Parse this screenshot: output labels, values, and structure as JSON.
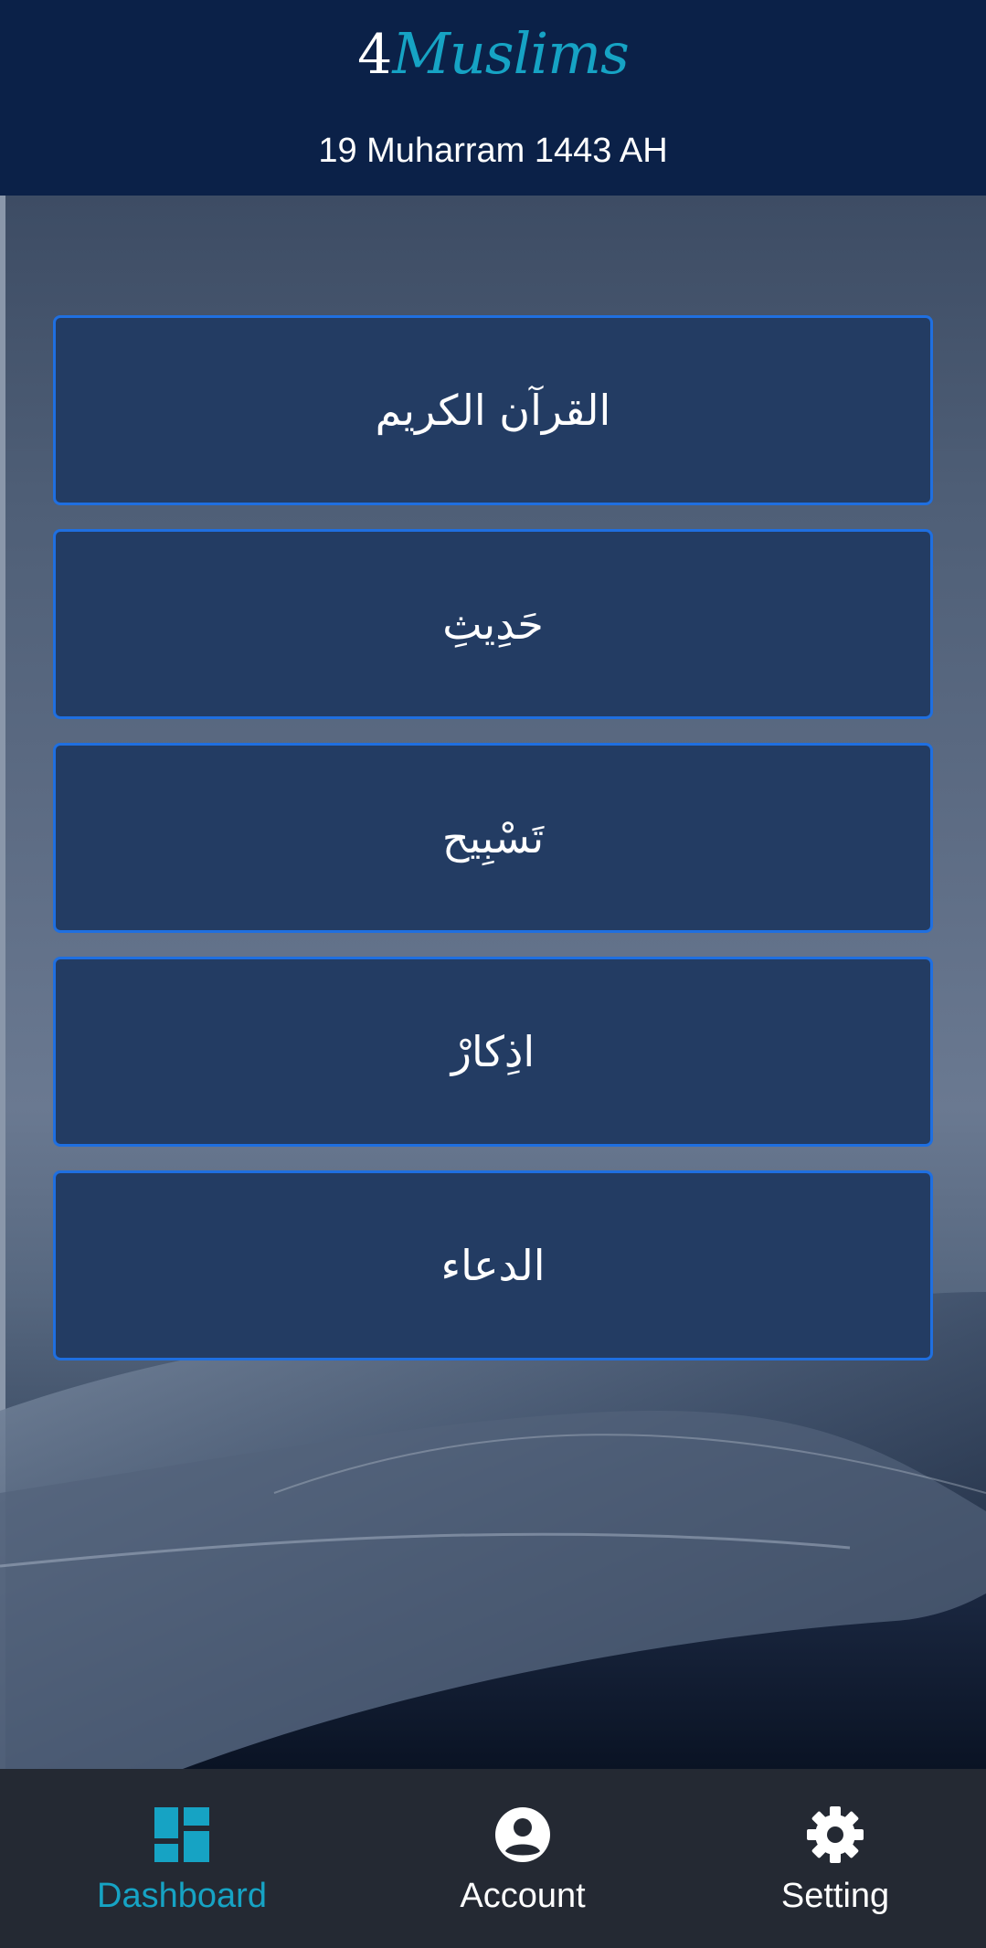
{
  "header": {
    "logo_number": "4",
    "logo_word": "Muslims",
    "hijri_date": "19 Muharram 1443 AH"
  },
  "menu": {
    "items": [
      {
        "label": "القرآن الكريم"
      },
      {
        "label": "حَدِيثِ"
      },
      {
        "label": "تَسْبِيح"
      },
      {
        "label": "اذِكارْ"
      },
      {
        "label": "الدعاء"
      }
    ]
  },
  "bottom_nav": {
    "items": [
      {
        "label": "Dashboard",
        "icon": "dashboard-icon",
        "active": true
      },
      {
        "label": "Account",
        "icon": "account-circle-icon",
        "active": false
      },
      {
        "label": "Setting",
        "icon": "gear-icon",
        "active": false
      }
    ]
  },
  "colors": {
    "header_bg": "#0b2148",
    "accent": "#16a3c4",
    "button_bg": "#233c63",
    "button_border": "#1f6fe0",
    "nav_bg": "#242933",
    "nav_inactive": "#ffffff"
  }
}
